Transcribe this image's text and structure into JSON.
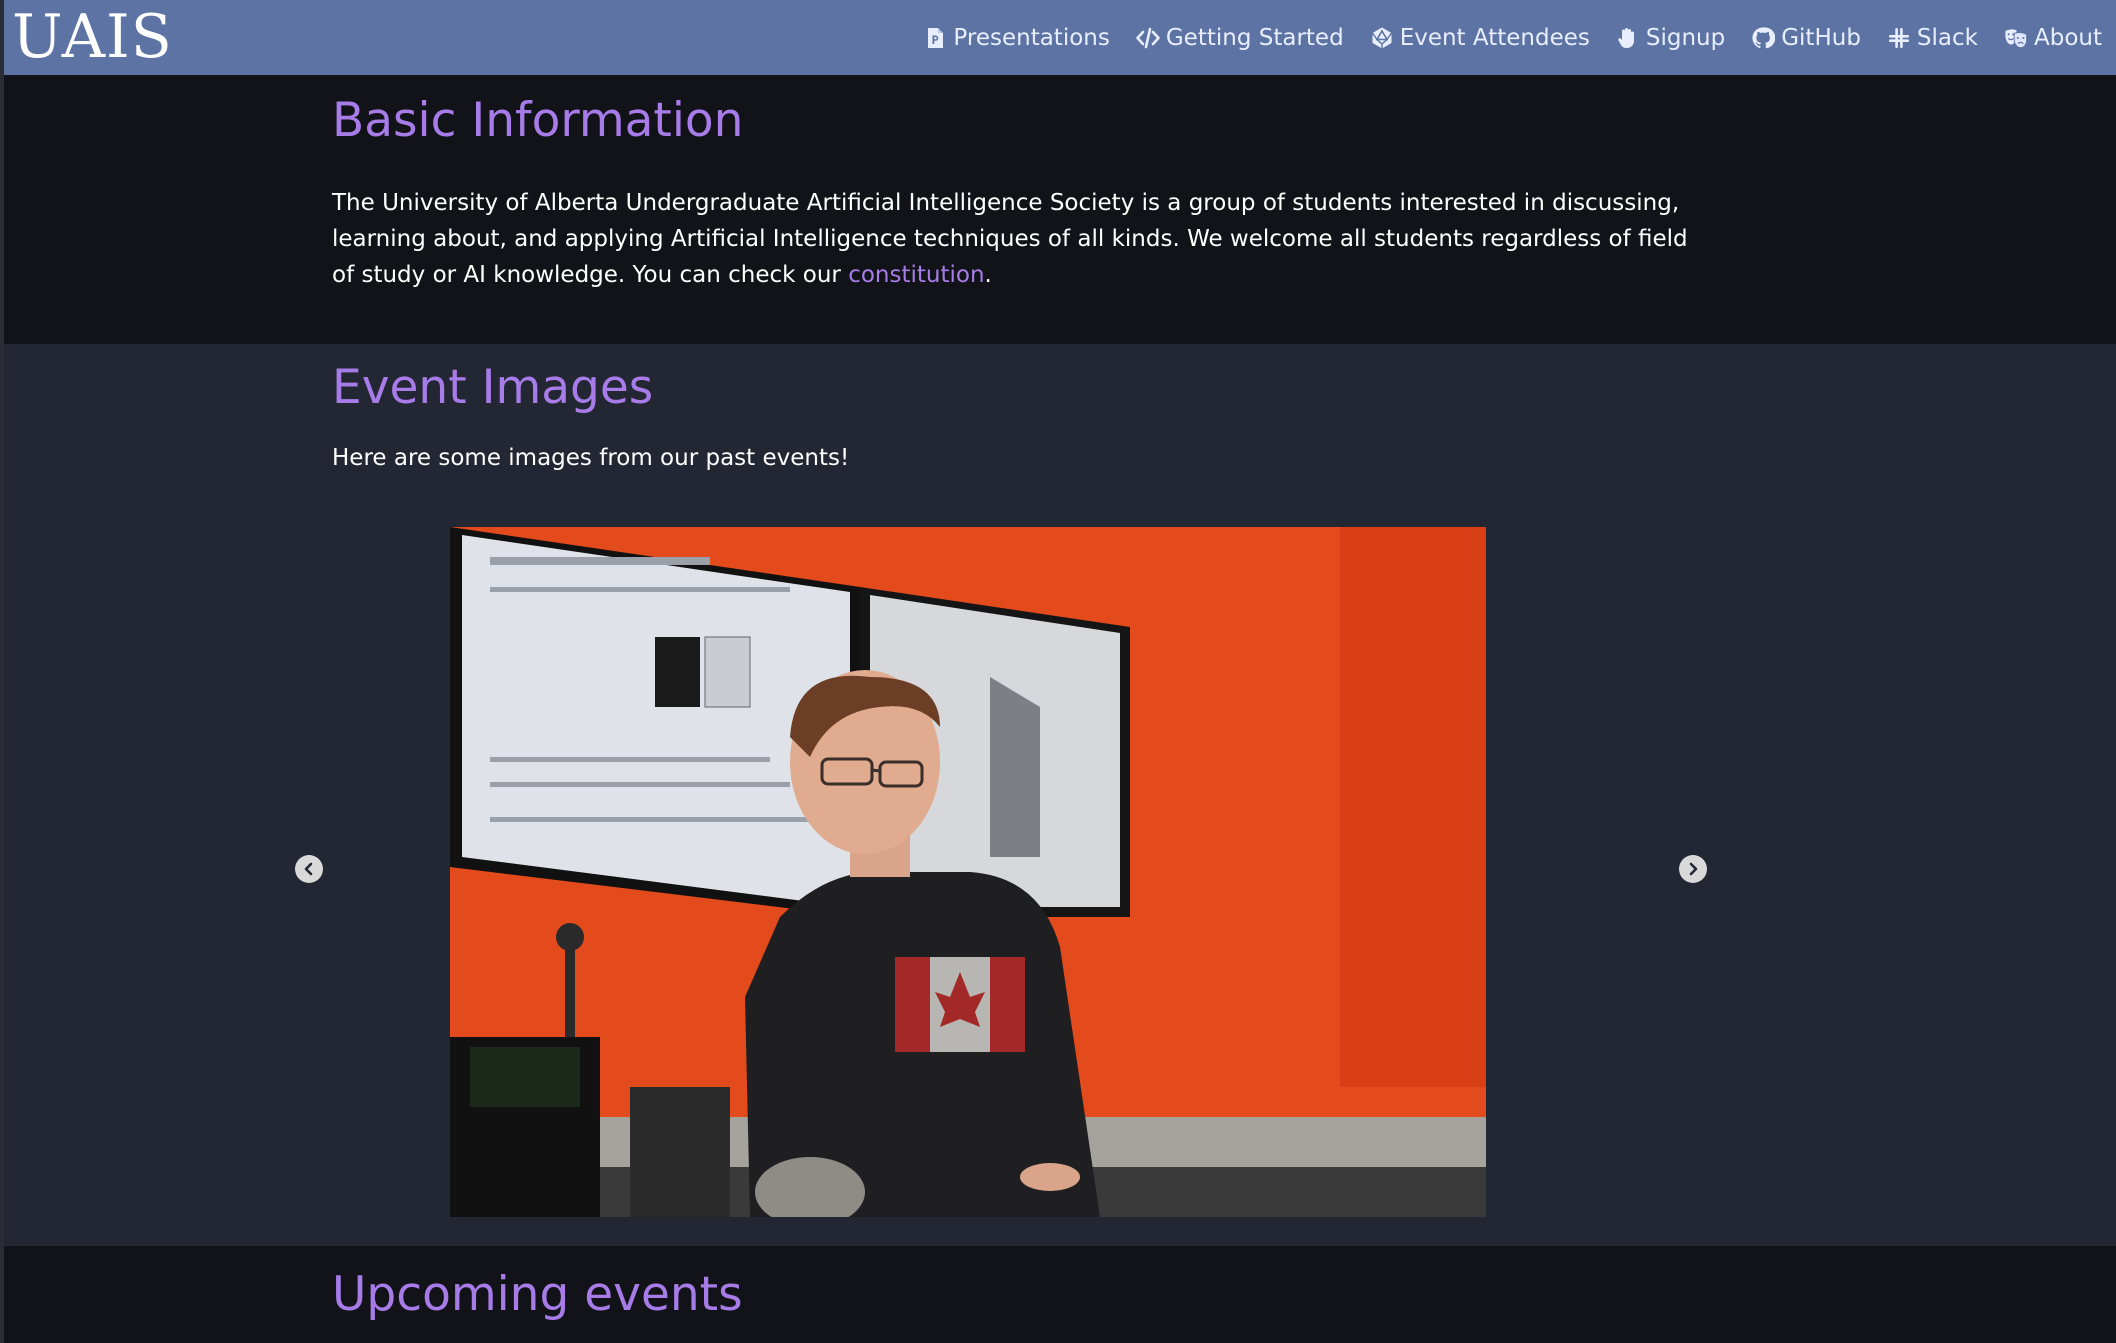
{
  "brand": {
    "title": "UAIS"
  },
  "nav": {
    "items": [
      {
        "label": "Presentations",
        "icon": "file-powerpoint-icon"
      },
      {
        "label": "Getting Started",
        "icon": "code-icon"
      },
      {
        "label": "Event Attendees",
        "icon": "dice-d20-icon"
      },
      {
        "label": "Signup",
        "icon": "signup-hand-icon"
      },
      {
        "label": "GitHub",
        "icon": "github-icon"
      },
      {
        "label": "Slack",
        "icon": "slack-icon"
      },
      {
        "label": "About",
        "icon": "theater-masks-icon"
      }
    ]
  },
  "basic_info": {
    "heading": "Basic Information",
    "text_before_link": "The University of Alberta Undergraduate Artificial Intelligence Society is a group of students interested in discussing, learning about, and applying Artificial Intelligence techniques of all kinds. We welcome all students regardless of field of study or AI knowledge. You can check our ",
    "link_text": "constitution",
    "text_after_link": "."
  },
  "event_images": {
    "heading": "Event Images",
    "intro": "Here are some images from our past events!",
    "prev_icon": "chevron-left-circle-icon",
    "next_icon": "chevron-right-circle-icon"
  },
  "upcoming": {
    "heading": "Upcoming events"
  },
  "colors": {
    "navbar": "#5c73a3",
    "accent": "#a77ce9",
    "dark_bg": "#121318",
    "section_bg": "#232633"
  }
}
